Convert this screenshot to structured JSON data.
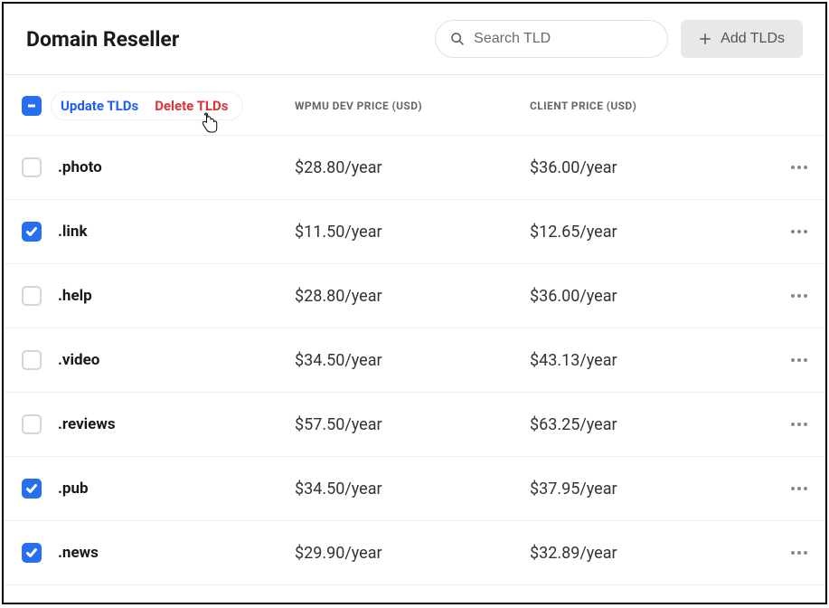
{
  "header": {
    "title": "Domain Reseller",
    "search_placeholder": "Search TLD",
    "add_button": "Add TLDs"
  },
  "toolbar": {
    "update_label": "Update TLDs",
    "delete_label": "Delete TLDs",
    "col_dev": "WPMU DEV PRICE (USD)",
    "col_client": "CLIENT PRICE (USD)"
  },
  "rows": [
    {
      "tld": ".photo",
      "dev_price": "$28.80/year",
      "client_price": "$36.00/year",
      "checked": false
    },
    {
      "tld": ".link",
      "dev_price": "$11.50/year",
      "client_price": "$12.65/year",
      "checked": true
    },
    {
      "tld": ".help",
      "dev_price": "$28.80/year",
      "client_price": "$36.00/year",
      "checked": false
    },
    {
      "tld": ".video",
      "dev_price": "$34.50/year",
      "client_price": "$43.13/year",
      "checked": false
    },
    {
      "tld": ".reviews",
      "dev_price": "$57.50/year",
      "client_price": "$63.25/year",
      "checked": false
    },
    {
      "tld": ".pub",
      "dev_price": "$34.50/year",
      "client_price": "$37.95/year",
      "checked": true
    },
    {
      "tld": ".news",
      "dev_price": "$29.90/year",
      "client_price": "$32.89/year",
      "checked": true
    }
  ]
}
